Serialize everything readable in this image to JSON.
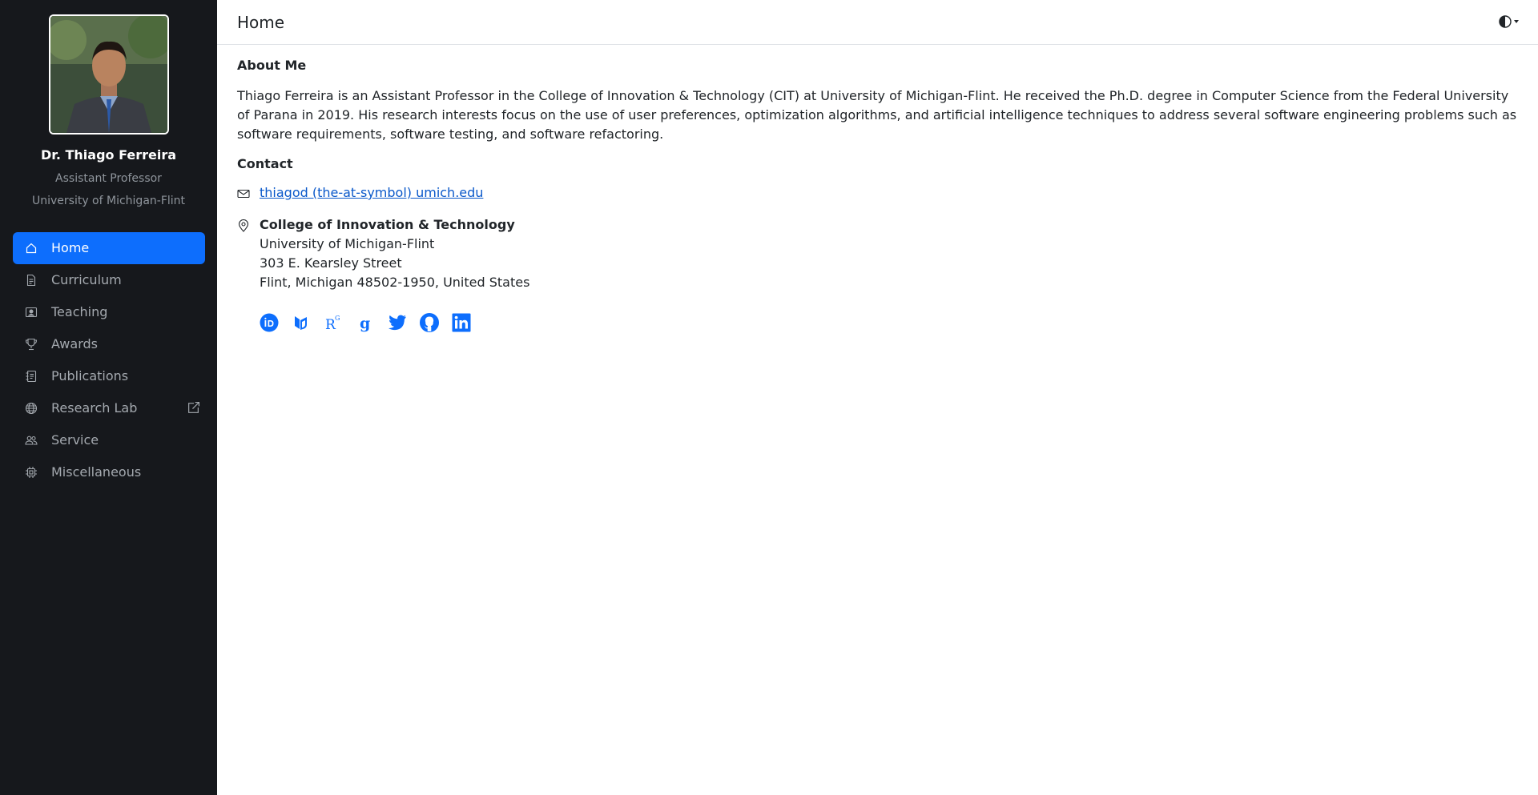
{
  "profile": {
    "name": "Dr. Thiago Ferreira",
    "role": "Assistant Professor",
    "affiliation": "University of Michigan-Flint"
  },
  "nav": {
    "items": [
      {
        "label": "Home",
        "icon": "house-icon",
        "active": true
      },
      {
        "label": "Curriculum",
        "icon": "file-text-icon"
      },
      {
        "label": "Teaching",
        "icon": "person-video-icon"
      },
      {
        "label": "Awards",
        "icon": "trophy-icon"
      },
      {
        "label": "Publications",
        "icon": "journal-text-icon"
      },
      {
        "label": "Research Lab",
        "icon": "globe-icon",
        "external_icon": "box-arrow-up-right-icon"
      },
      {
        "label": "Service",
        "icon": "people-icon"
      },
      {
        "label": "Miscellaneous",
        "icon": "cpu-icon"
      }
    ]
  },
  "header": {
    "title": "Home",
    "theme_toggle_icon": "circle-half-icon"
  },
  "about": {
    "heading": "About Me",
    "text": "Thiago Ferreira is an Assistant Professor in the College of Innovation & Technology (CIT) at University of Michigan-Flint. He received the Ph.D. degree in Computer Science from the Federal University of Parana in 2019. His research interests focus on the use of user preferences, optimization algorithms, and artificial intelligence techniques to address several software engineering problems such as software requirements, software testing, and software refactoring."
  },
  "contact": {
    "heading": "Contact",
    "email": "thiagod (the-at-symbol) umich.edu",
    "address": {
      "line1": "College of Innovation & Technology",
      "line2": "University of Michigan-Flint",
      "line3": "303 E. Kearsley Street",
      "line4": "Flint, Michigan 48502-1950, United States"
    }
  },
  "socials": [
    {
      "icon": "orcid-icon"
    },
    {
      "icon": "dblp-icon"
    },
    {
      "icon": "researchgate-icon"
    },
    {
      "icon": "google-scholar-icon"
    },
    {
      "icon": "twitter-icon"
    },
    {
      "icon": "github-icon"
    },
    {
      "icon": "linkedin-icon"
    }
  ],
  "colors": {
    "sidebar_bg": "#16181c",
    "accent": "#0d6efd",
    "link": "#0a58ca"
  }
}
